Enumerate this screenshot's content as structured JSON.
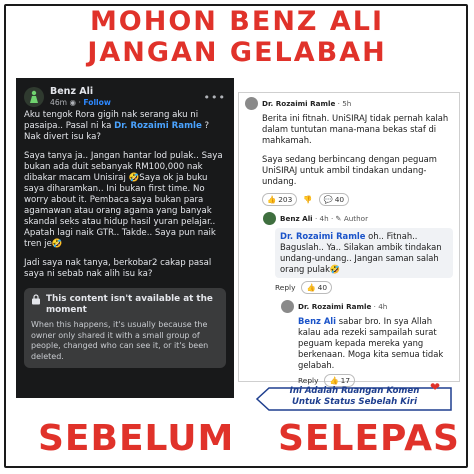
{
  "header": {
    "line1": "MOHON BENZ ALI",
    "line2": "JANGAN GELABAH"
  },
  "labels": {
    "before": "SEBELUM",
    "after": "SELEPAS"
  },
  "fb_post": {
    "author": "Benz Ali",
    "time": "46m",
    "follow": "Follow",
    "p1_a": "Aku tengok Rora gigih nak serang aku ni pasaipa.. Pasal ni ka ",
    "p1_mention": "Dr. Rozaimi Ramle",
    "p1_b": " ? Nak divert isu ka?",
    "p2": "Saya tanya ja.. Jangan hantar lod pulak.. Saya bukan ada duit sebanyak RM100,000 nak dibakar macam Unisiraj 🤣Saya ok ja buku saya diharamkan.. Ini bukan first time. No worry about it. Pembaca saya bukan para agamawan atau orang agama yang banyak skandal seks atau hidup hasil yuran pelajar.. Apatah lagi naik GTR.. Takde.. Saya pun naik tren je🤣",
    "p3": "Jadi saya nak tanya, berkobar2 cakap pasal saya ni sebab nak alih isu ka?",
    "blocked_title": "This content isn't available at the moment",
    "blocked_text": "When this happens, it's usually because the owner only shared it with a small group of people, changed who can see it, or it's been deleted."
  },
  "comments": {
    "c1_name": "Dr. Rozaimi Ramle",
    "c1_time": "5h",
    "c1_p1": "Berita ini fitnah. UniSIRAJ tidak pernah kalah dalam tuntutan mana-mana bekas staf di mahkamah.",
    "c1_p2": "Saya sedang berbincang dengan peguam UniSIRAJ untuk ambil tindakan undang-undang.",
    "c1_reply": "Reply",
    "c1_count": "203",
    "c1_count2": "40",
    "c2_name": "Benz Ali",
    "c2_time": "4h",
    "c2_badge": "Author",
    "c2_mention": "Dr. Rozaimi Ramle",
    "c2_text": " oh.. Fitnah.. Baguslah.. Ya.. Silakan ambik tindakan undang-undang.. Jangan saman salah orang pulak🤣",
    "c2_reply": "Reply",
    "c2_count": "40",
    "c3_name": "Dr. Rozaimi Ramle",
    "c3_time": "4h",
    "c3_mention": "Benz Ali",
    "c3_text": " sabar bro. In sya Allah kalau ada rezeki sampailah surat peguam kepada mereka yang berkenaan. Moga kita semua tidak gelabah.",
    "c3_reply": "Reply",
    "c3_count": "17"
  },
  "note": {
    "line1": "Ini Adalah Ruangan Komen",
    "line2": "Untuk Status Sebelah Kiri"
  }
}
